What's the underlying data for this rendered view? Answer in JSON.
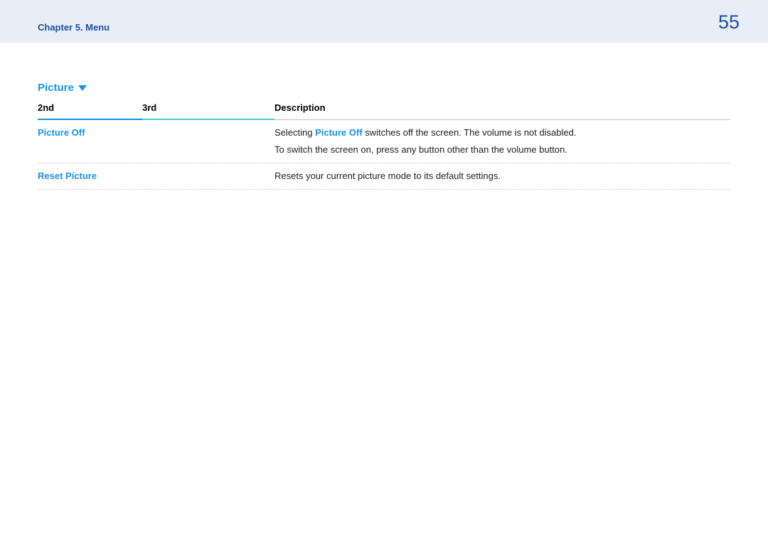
{
  "header": {
    "chapter": "Chapter 5. Menu",
    "page_number": "55"
  },
  "section": {
    "title": "Picture"
  },
  "table": {
    "headers": {
      "col1": "2nd",
      "col2": "3rd",
      "col3": "Description"
    },
    "rows": [
      {
        "col1": "Picture Off",
        "col2": "",
        "desc_pre": "Selecting ",
        "desc_highlight": "Picture Off",
        "desc_post": " switches off the screen. The volume is not disabled.",
        "desc_line2": "To switch the screen on, press any button other than the volume button."
      },
      {
        "col1": "Reset Picture",
        "col2": "",
        "desc_pre": "",
        "desc_highlight": "",
        "desc_post": "Resets your current picture mode to its default settings.",
        "desc_line2": ""
      }
    ]
  }
}
